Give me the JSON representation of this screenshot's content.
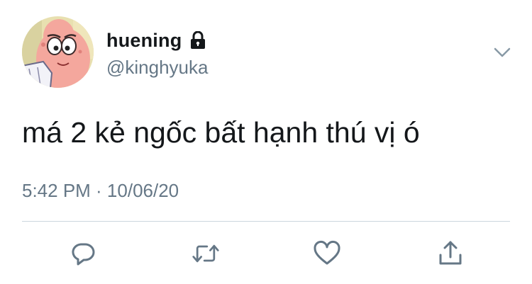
{
  "user": {
    "display_name": "huening",
    "handle": "@kinghyuka",
    "avatar_icon": "patrick-star-avatar",
    "protected_icon": "lock-icon"
  },
  "tweet": {
    "text": "má 2 kẻ ngốc bất hạnh thú vị ó",
    "timestamp": "5:42 PM · 10/06/20"
  },
  "actions": {
    "reply_icon": "reply-icon",
    "retweet_icon": "retweet-icon",
    "like_icon": "heart-icon",
    "share_icon": "share-icon"
  },
  "colors": {
    "text_primary": "#14171a",
    "text_secondary": "#657786",
    "divider": "#ccd6dd"
  }
}
